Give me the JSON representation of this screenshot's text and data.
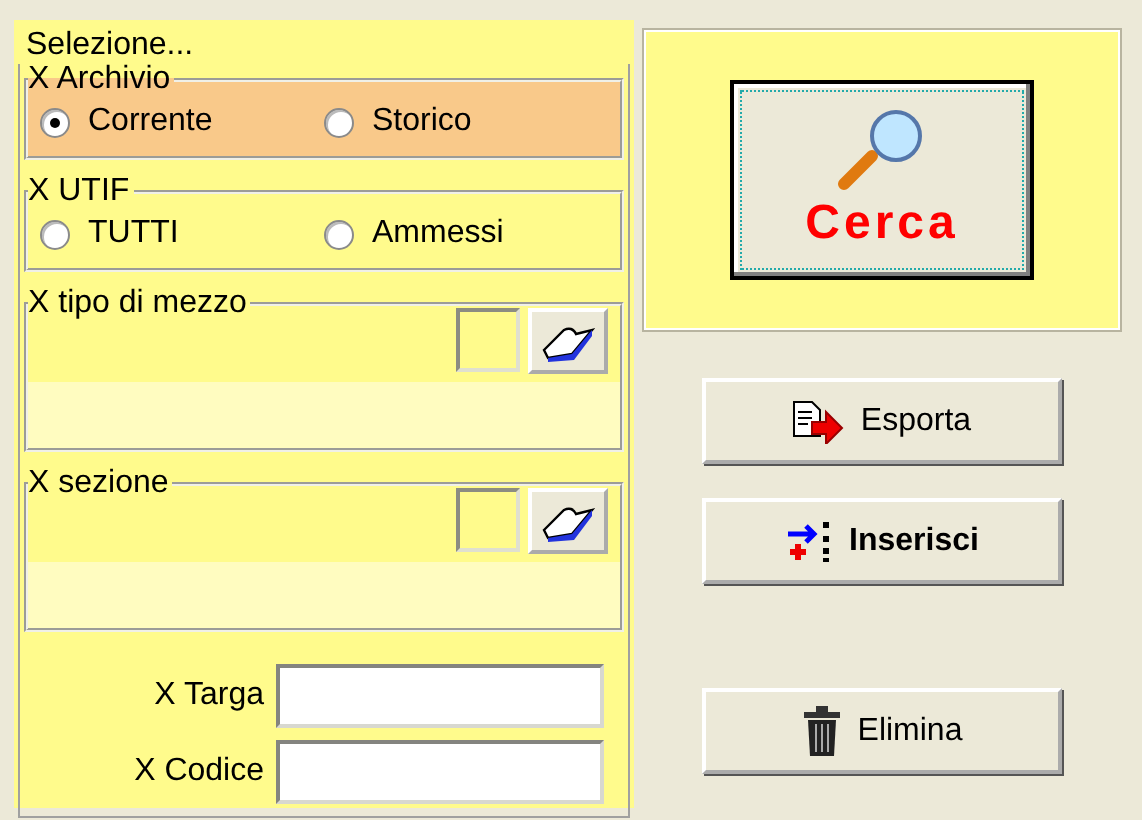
{
  "selection": {
    "title": "Selezione...",
    "groups": [
      {
        "kind": "radio",
        "title": "X Archivio",
        "highlighted": true,
        "options": [
          {
            "label": "Corrente",
            "selected": true
          },
          {
            "label": "Storico",
            "selected": false
          }
        ]
      },
      {
        "kind": "radio",
        "title": "X UTIF",
        "highlighted": false,
        "options": [
          {
            "label": "TUTTI",
            "selected": false
          },
          {
            "label": "Ammessi",
            "selected": false
          }
        ]
      },
      {
        "kind": "lookup",
        "title": "X tipo di mezzo",
        "highlighted": false
      },
      {
        "kind": "lookup",
        "title": "X sezione",
        "highlighted": false
      }
    ],
    "fields": [
      {
        "label": "X Targa"
      },
      {
        "label": "X Codice"
      }
    ]
  },
  "search_button": {
    "label": "Cerca"
  },
  "buttons": [
    {
      "kind": "export",
      "label": "Esporta",
      "emphasized": false
    },
    {
      "kind": "insert",
      "label": "Inserisci",
      "emphasized": true
    },
    {
      "kind": "delete",
      "label": "Elimina",
      "emphasized": false
    }
  ]
}
